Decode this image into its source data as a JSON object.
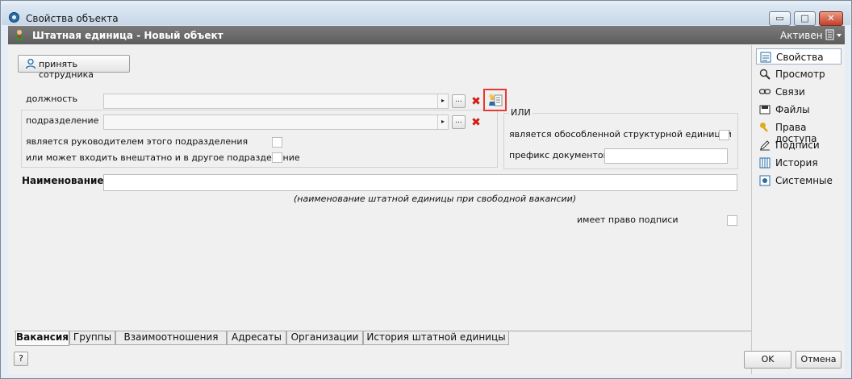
{
  "window": {
    "title": "Свойства объекта",
    "minimize": "▭",
    "maximize": "□",
    "close": "✕"
  },
  "header": {
    "title": "Штатная единица - Новый объект",
    "status": "Активен"
  },
  "toolbar": {
    "hire_label": "принять сотрудника"
  },
  "form": {
    "position_label": "должность",
    "position_value": "",
    "division_label": "подразделение",
    "division_value": "",
    "is_head_label": "является руководителем этого подразделения",
    "is_head_checked": false,
    "extra_label": "или может входить внештатно и в другое подразделение",
    "extra_checked": false,
    "ili_label": "ИЛИ",
    "separate_unit_label": "является обособленной структурной единицей",
    "separate_unit_checked": false,
    "doc_prefix_label": "префикс документов",
    "doc_prefix_value": "",
    "name_label": "Наименование",
    "name_value": "",
    "name_hint": "(наименование штатной единицы при свободной вакансии)",
    "sign_right_label": "имеет право подписи",
    "sign_right_checked": false,
    "dots_label": "...",
    "arrow_glyph": "▸",
    "clear_glyph": "✖"
  },
  "tabs": [
    {
      "label": "Вакансия",
      "active": true
    },
    {
      "label": "Группы",
      "active": false
    },
    {
      "label": "Взаимоотношения",
      "active": false
    },
    {
      "label": "Адресаты",
      "active": false
    },
    {
      "label": "Организации",
      "active": false
    },
    {
      "label": "История штатной единицы",
      "active": false
    }
  ],
  "sidebar": {
    "items": [
      {
        "label": "Свойства",
        "icon": "properties-icon",
        "active": true
      },
      {
        "label": "Просмотр",
        "icon": "magnifier-icon",
        "active": false
      },
      {
        "label": "Связи",
        "icon": "link-icon",
        "active": false
      },
      {
        "label": "Файлы",
        "icon": "files-icon",
        "active": false
      },
      {
        "label": "Права доступа",
        "icon": "key-icon",
        "active": false
      },
      {
        "label": "Подписи",
        "icon": "pen-icon",
        "active": false
      },
      {
        "label": "История",
        "icon": "history-icon",
        "active": false
      },
      {
        "label": "Системные",
        "icon": "system-icon",
        "active": false
      }
    ]
  },
  "footer": {
    "help_label": "?",
    "ok_label": "OK",
    "cancel_label": "Отмена"
  },
  "colors": {
    "highlight": "#e53935",
    "header_bg": "#6a6a6a",
    "accent": "#2a6da6"
  }
}
